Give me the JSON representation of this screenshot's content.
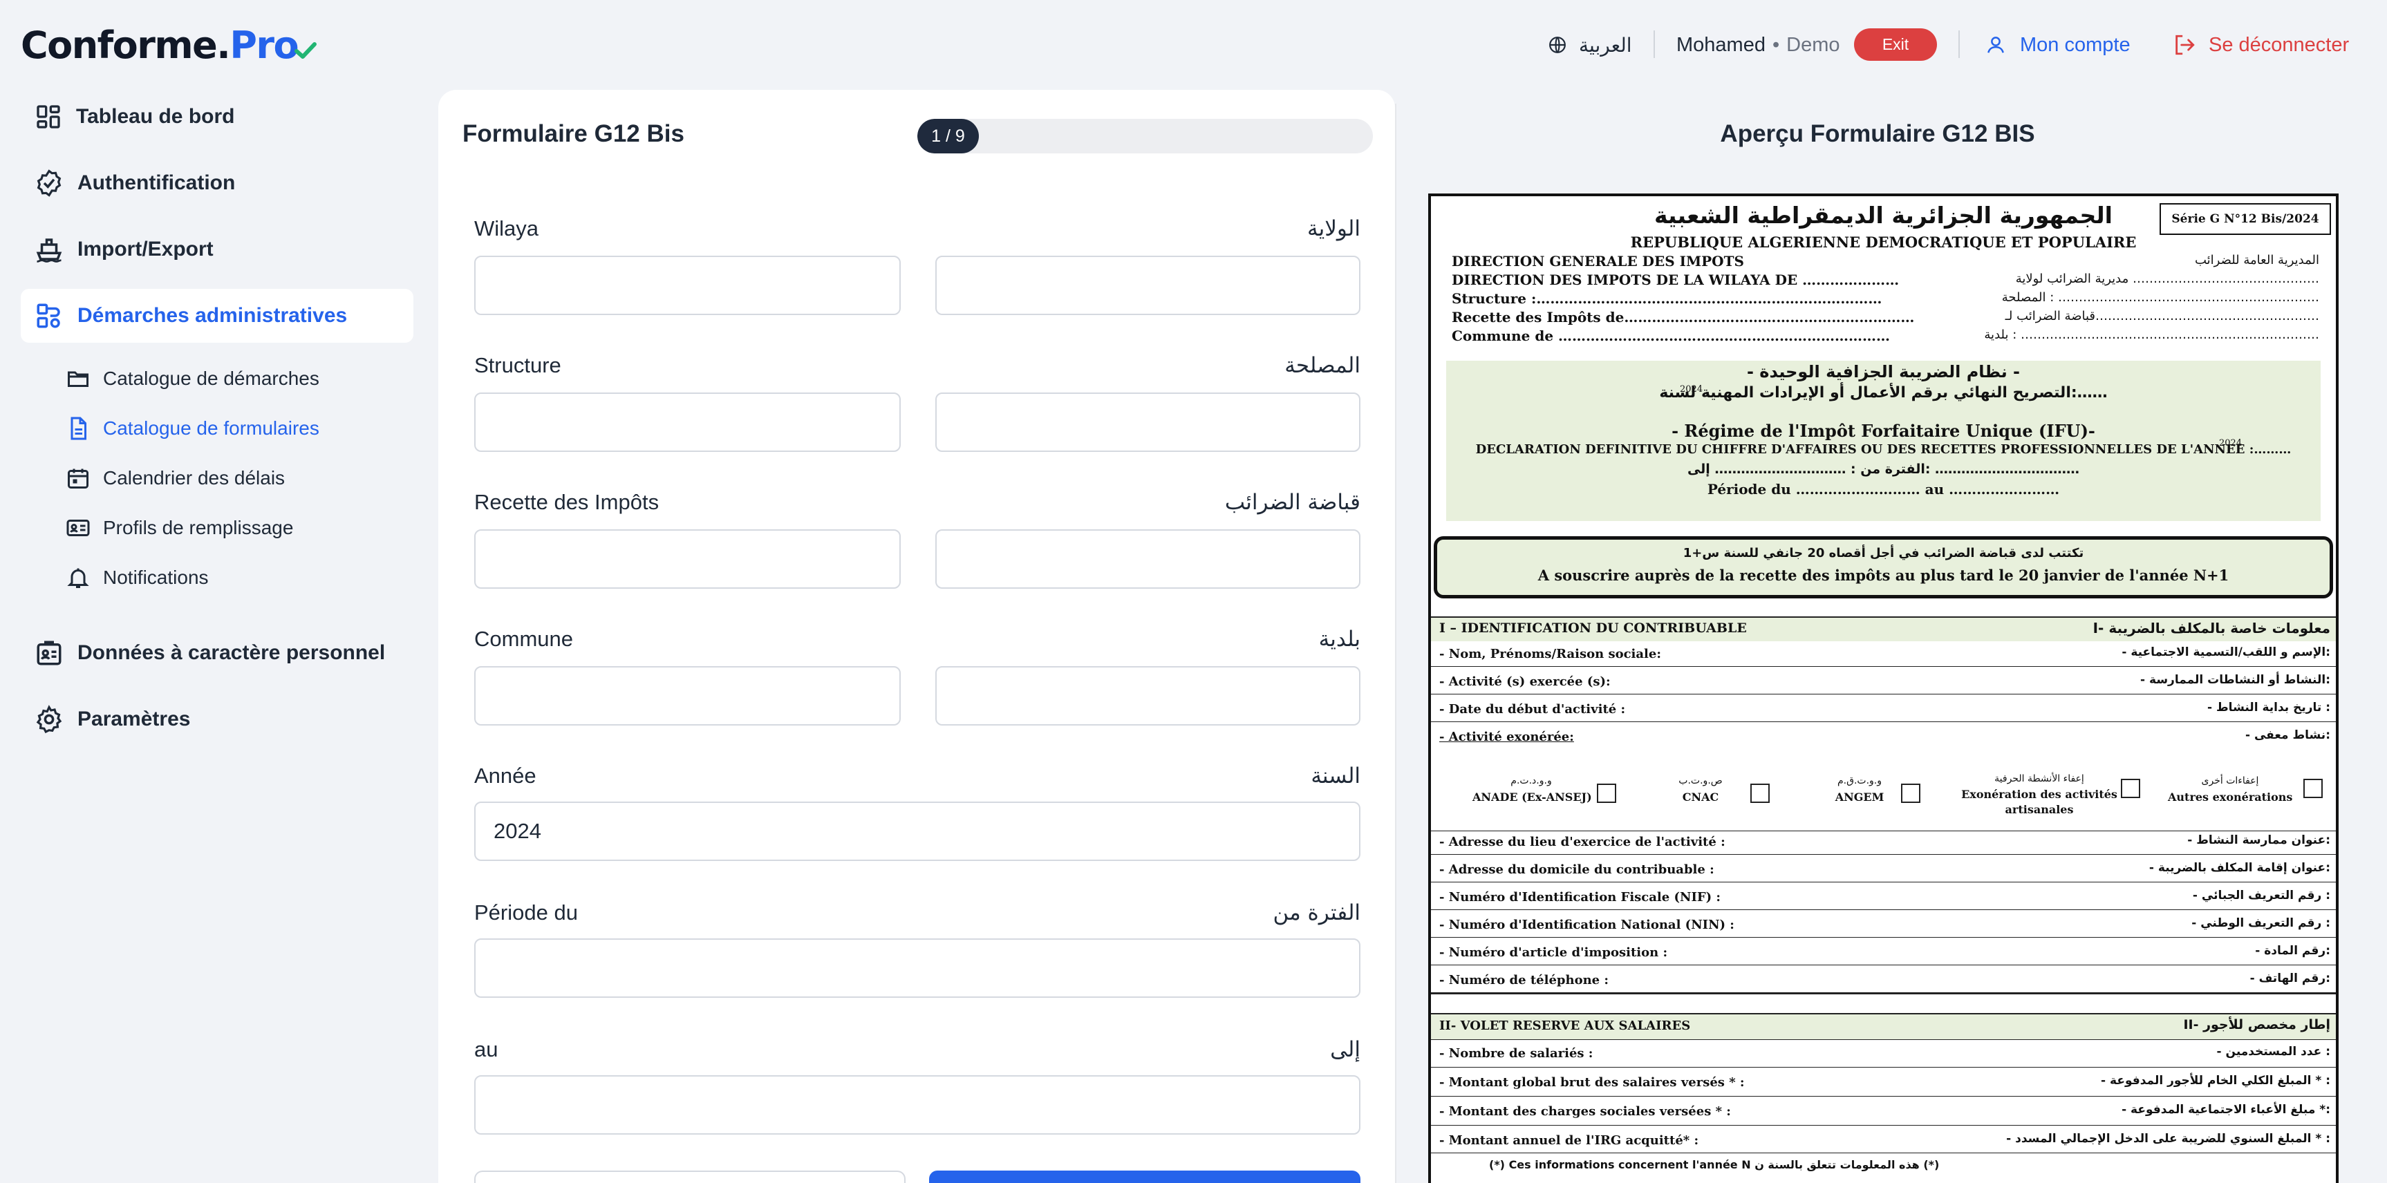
{
  "app": {
    "logo_main": "Conforme.",
    "logo_accent": "Pro"
  },
  "header": {
    "language": "العربية",
    "user_name": "Mohamed",
    "user_separator": "•",
    "user_mode": "Demo",
    "exit_label": "Exit",
    "account_label": "Mon compte",
    "logout_label": "Se déconnecter",
    "accent_color": "#2563eb",
    "danger_color": "#dc4040"
  },
  "sidebar": {
    "items": [
      {
        "label": "Tableau de bord",
        "icon": "dashboard-icon"
      },
      {
        "label": "Authentification",
        "icon": "badge-check-icon"
      },
      {
        "label": "Import/Export",
        "icon": "ship-icon"
      },
      {
        "label": "Démarches administratives",
        "icon": "workflow-icon",
        "active": true
      },
      {
        "label": "Données à caractère personnel",
        "icon": "id-badge-icon"
      },
      {
        "label": "Paramètres",
        "icon": "gear-icon"
      }
    ],
    "subitems": [
      {
        "label": "Catalogue de démarches",
        "icon": "folder-icon"
      },
      {
        "label": "Catalogue de formulaires",
        "icon": "file-icon",
        "active": true
      },
      {
        "label": "Calendrier des délais",
        "icon": "calendar-icon"
      },
      {
        "label": "Profils de remplissage",
        "icon": "id-card-icon"
      },
      {
        "label": "Notifications",
        "icon": "bell-icon"
      }
    ]
  },
  "form": {
    "title": "Formulaire G12 Bis",
    "progress_text": "1 / 9",
    "progress_fraction": 0.111,
    "fields": [
      {
        "label": "Wilaya",
        "label_ar": "الولاية",
        "value": "",
        "dual": true
      },
      {
        "label": "Structure",
        "label_ar": "المصلحة",
        "value": "",
        "dual": true
      },
      {
        "label": "Recette des Impôts",
        "label_ar": "قباضة الضرائب",
        "value": "",
        "dual": true
      },
      {
        "label": "Commune",
        "label_ar": "بلدية",
        "value": "",
        "dual": true
      },
      {
        "label": "Année",
        "label_ar": "السنة",
        "value": "2024",
        "dual": false
      },
      {
        "label": "Période du",
        "label_ar": "الفترة من",
        "value": "",
        "dual": false
      },
      {
        "label": "au",
        "label_ar": "إلى",
        "value": "",
        "dual": false
      }
    ]
  },
  "preview": {
    "title": "Aperçu Formulaire G12 BIS",
    "doc": {
      "title_ar": "الجمهورية الجزائرية الديمقراطية الشعبية",
      "title_fr": "REPUBLIQUE ALGERIENNE DEMOCRATIQUE ET POPULAIRE",
      "serie": "Série G N°12 Bis/2024",
      "dir_left": [
        "DIRECTION GENERALE DES IMPOTS",
        "DIRECTION DES IMPOTS DE LA WILAYA DE …………………",
        "Structure :…………………………………………………………………",
        "Recette des Impôts de………………………………………………………",
        "Commune de ………………………………………………………………"
      ],
      "dir_right": [
        "المديرية العامة للضرائب",
        "مديرية الضرائب لولاية ………………………………………",
        "المصلحة : ………………………………………………………",
        "قباضة الضرائب لـ………………………………………………",
        "بلدية : ………………………………………………………………"
      ],
      "regime_ar1": "- نظام الضريبة الجزافية الوحيدة -",
      "regime_ar2": "التصريح النهائي برقم الأعمال أو الإيرادات المهنية لسنة:……",
      "regime_fr1": "- Régime de l'Impôt Forfaitaire Unique (IFU)-",
      "regime_fr2": "DECLARATION DEFINITIVE DU CHIFFRE D'AFFAIRES OU DES RECETTES PROFESSIONNELLES DE L'ANNEE :………",
      "year_small": "2024",
      "period_ar": "الفترة من : ………………………… إلى: ……………………………",
      "period_fr": "Période du ……………………… au ……………………",
      "notice_ar": "تكتتب لدى قباضة الضرائب في أجل أقصاه 20 جانفي للسنة س+1",
      "notice_fr": "A souscrire auprès de la recette des impôts au plus tard le 20 janvier de l'année N+1",
      "section1_fr": "I – IDENTIFICATION DU CONTRIBUABLE",
      "section1_ar": "I- معلومات خاصة بالمكلف بالضريبة",
      "rows1": [
        {
          "fr": "-  Nom, Prénoms/Raison sociale:",
          "ar": "- الإسم و اللقب/التسمية الاجتماعية:"
        },
        {
          "fr": "-  Activité (s) exercée (s):",
          "ar": "- النشاط أو النشاطات الممارسة:"
        },
        {
          "fr": "-  Date du début d'activité :",
          "ar": "- تاريخ بداية النشاط :"
        },
        {
          "fr": "-  Activité exonérée:",
          "ar": "- نشاط معفى:"
        }
      ],
      "exemptions": [
        {
          "ar": "و.و.د.ت.م",
          "fr": "ANADE (Ex-ANSEJ)"
        },
        {
          "ar": "ص.و.ت.ب",
          "fr": "CNAC"
        },
        {
          "ar": "و.و.ت.ق.م",
          "fr": "ANGEM"
        },
        {
          "ar": "إعفاء الأنشطة الحرفية",
          "fr": "Exonération des activités",
          "fr2": "artisanales"
        },
        {
          "ar": "إعفاءات أخرى",
          "fr": "Autres exonérations"
        }
      ],
      "rows2": [
        {
          "fr": "-  Adresse du lieu d'exercice de l'activité :",
          "ar": "- عنوان ممارسة النشاط:"
        },
        {
          "fr": "-  Adresse du domicile du contribuable :",
          "ar": "- عنوان إقامة المكلف بالضريبة:"
        },
        {
          "fr": "-  Numéro d'Identification Fiscale (NIF) :",
          "ar": "- رقم التعريف الجبائي :"
        },
        {
          "fr": "-  Numéro d'Identification National (NIN) :",
          "ar": "- رقم التعريف الوطني :"
        },
        {
          "fr": "-  Numéro d'article d'imposition :",
          "ar": "- رقم المادة:"
        },
        {
          "fr": "-  Numéro de téléphone :",
          "ar": "- رقم الهاتف:"
        }
      ],
      "section2_fr": "II- VOLET RESERVE AUX SALAIRES",
      "section2_ar": "II- إطار مخصص للأجور",
      "rows3": [
        {
          "fr": "- Nombre de salariés :",
          "ar": "- عدد المستخدمين :"
        },
        {
          "fr": "- Montant global brut des salaires versés * :",
          "ar": "- المبلغ الكلي الخام للأجور المدفوعة * :"
        },
        {
          "fr": "- Montant des charges sociales versées * :",
          "ar": "- مبلغ الأعباء الاجتماعية المدفوعة *:"
        },
        {
          "fr": "- Montant annuel de l'IRG acquitté* :",
          "ar": "- المبلغ السنوي للضريبة على الدخل الإجمالي المسدد * :"
        }
      ],
      "footnote": "(*) Ces informations concernent  l'année N  هذه المعلومات تتعلق بالسنة ن (*)"
    }
  }
}
